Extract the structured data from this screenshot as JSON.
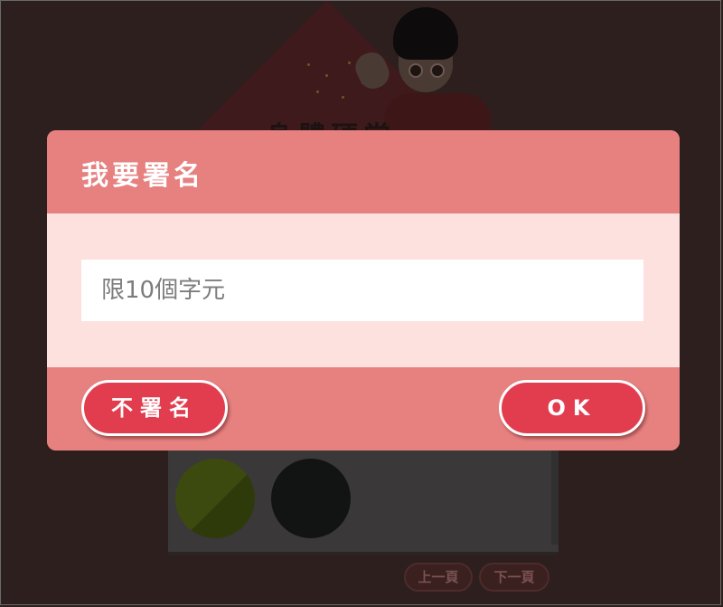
{
  "background": {
    "title_partial": "身體硬當",
    "pagination": {
      "prev_label": "上一頁",
      "next_label": "下一頁"
    },
    "color_swatches": [
      {
        "name": "olive-green",
        "color": "#3d4a0f"
      },
      {
        "name": "black",
        "color": "#121414"
      }
    ]
  },
  "dialog": {
    "title": "我要署名",
    "input": {
      "value": "",
      "placeholder": "限10個字元"
    },
    "buttons": {
      "skip_label": "不署名",
      "ok_label": "OK"
    }
  },
  "colors": {
    "dialog_header": "#e78180",
    "dialog_body": "#fce1df",
    "button": "#e23d4f",
    "overlay": "#2e1f1f"
  }
}
